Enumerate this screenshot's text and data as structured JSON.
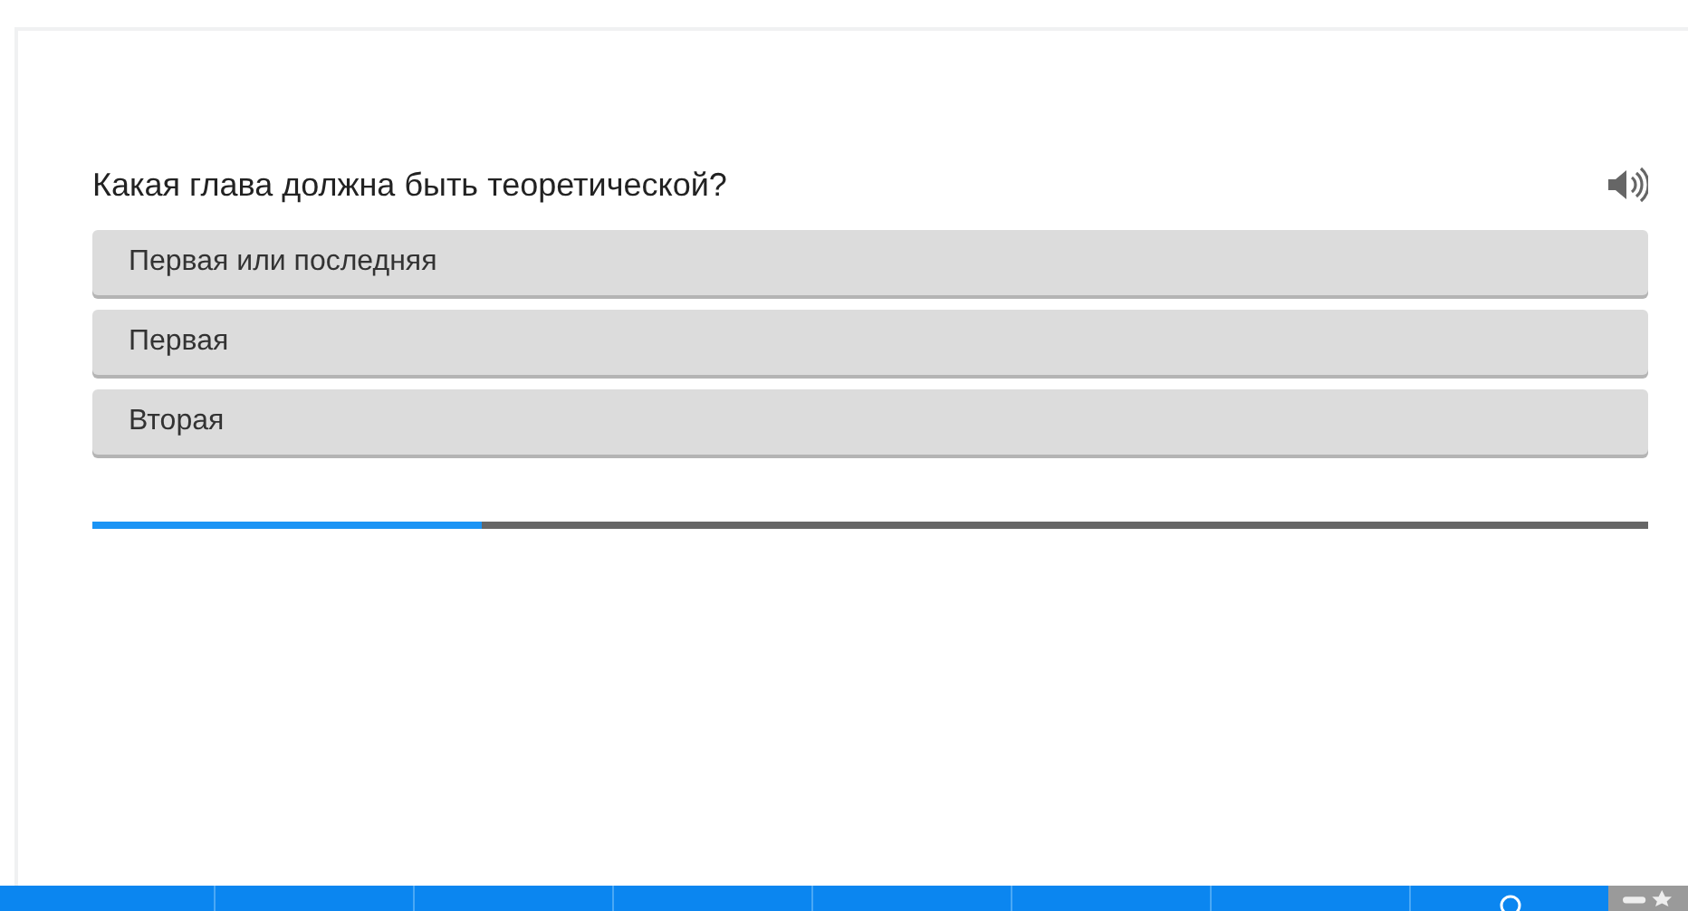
{
  "question": {
    "text": "Какая глава должна быть теоретической?"
  },
  "answers": [
    {
      "label": "Первая или последняя"
    },
    {
      "label": "Первая"
    },
    {
      "label": "Вторая"
    }
  ],
  "progress": {
    "level": 0.25
  },
  "bottom_bar": {
    "segments": [
      {
        "kind": "plain"
      },
      {
        "kind": "plain"
      },
      {
        "kind": "plain"
      },
      {
        "kind": "plain"
      },
      {
        "kind": "plain"
      },
      {
        "kind": "plain"
      },
      {
        "kind": "plain"
      },
      {
        "kind": "search"
      },
      {
        "kind": "tools"
      }
    ]
  }
}
